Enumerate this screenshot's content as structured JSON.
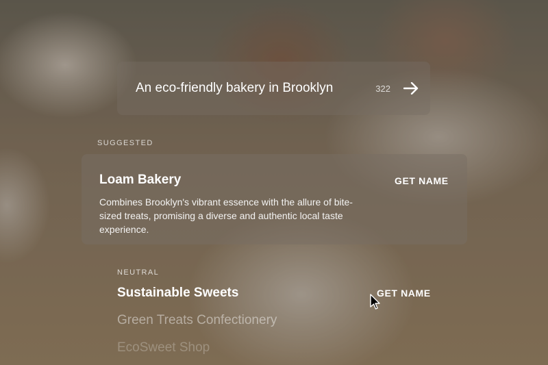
{
  "search": {
    "query": "An eco-friendly bakery in Brooklyn",
    "count": "322",
    "submit_icon": "arrow-right-icon"
  },
  "suggested": {
    "section_label": "SUGGESTED",
    "name": "Loam Bakery",
    "description": "Combines Brooklyn's vibrant essence with the allure of bite-sized treats, promising a diverse and authentic local taste experience.",
    "action_label": "GET NAME"
  },
  "neutral": {
    "section_label": "NEUTRAL",
    "action_label": "GET NAME",
    "items": [
      {
        "name": "Sustainable Sweets"
      },
      {
        "name": "Green Treats Confectionery"
      },
      {
        "name": "EcoSweet Shop"
      }
    ]
  },
  "colors": {
    "text": "#ffffff",
    "panel": "rgba(120,110,100,0.5)"
  }
}
